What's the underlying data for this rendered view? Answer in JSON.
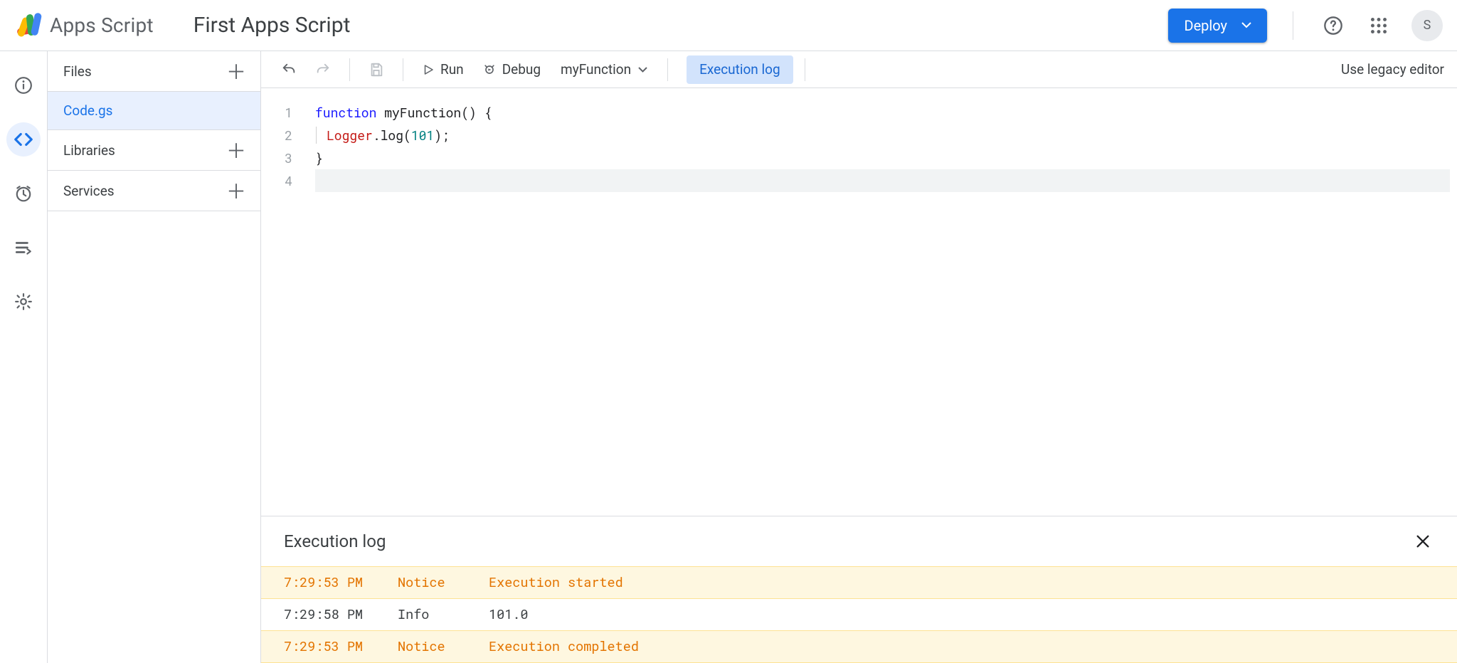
{
  "header": {
    "product_name": "Apps Script",
    "project_title": "First Apps Script",
    "deploy_label": "Deploy",
    "avatar_initial": "S"
  },
  "rail": {
    "items": [
      "overview",
      "editor",
      "triggers",
      "executions",
      "settings"
    ],
    "active": "editor"
  },
  "sidebar": {
    "files_label": "Files",
    "libraries_label": "Libraries",
    "services_label": "Services",
    "file_name": "Code.gs"
  },
  "toolbar": {
    "run_label": "Run",
    "debug_label": "Debug",
    "fn_name": "myFunction",
    "exec_log_label": "Execution log",
    "legacy_label": "Use legacy editor"
  },
  "code": {
    "lines": [
      {
        "n": "1",
        "tokens": [
          {
            "t": "function ",
            "c": "kw-blue"
          },
          {
            "t": "myFunction() {",
            "c": ""
          }
        ]
      },
      {
        "n": "2",
        "tokens": [
          {
            "t": "Logger",
            "c": "kw-red"
          },
          {
            "t": ".log(",
            "c": ""
          },
          {
            "t": "101",
            "c": "kw-teal"
          },
          {
            "t": ");",
            "c": ""
          }
        ],
        "indent": true
      },
      {
        "n": "3",
        "tokens": [
          {
            "t": "}",
            "c": ""
          }
        ]
      },
      {
        "n": "4",
        "tokens": [],
        "current": true
      }
    ]
  },
  "log": {
    "title": "Execution log",
    "rows": [
      {
        "time": "7:29:53 PM",
        "level": "Notice",
        "msg": "Execution started",
        "kind": "notice"
      },
      {
        "time": "7:29:58 PM",
        "level": "Info",
        "msg": "101.0",
        "kind": "info"
      },
      {
        "time": "7:29:53 PM",
        "level": "Notice",
        "msg": "Execution completed",
        "kind": "notice"
      }
    ]
  }
}
